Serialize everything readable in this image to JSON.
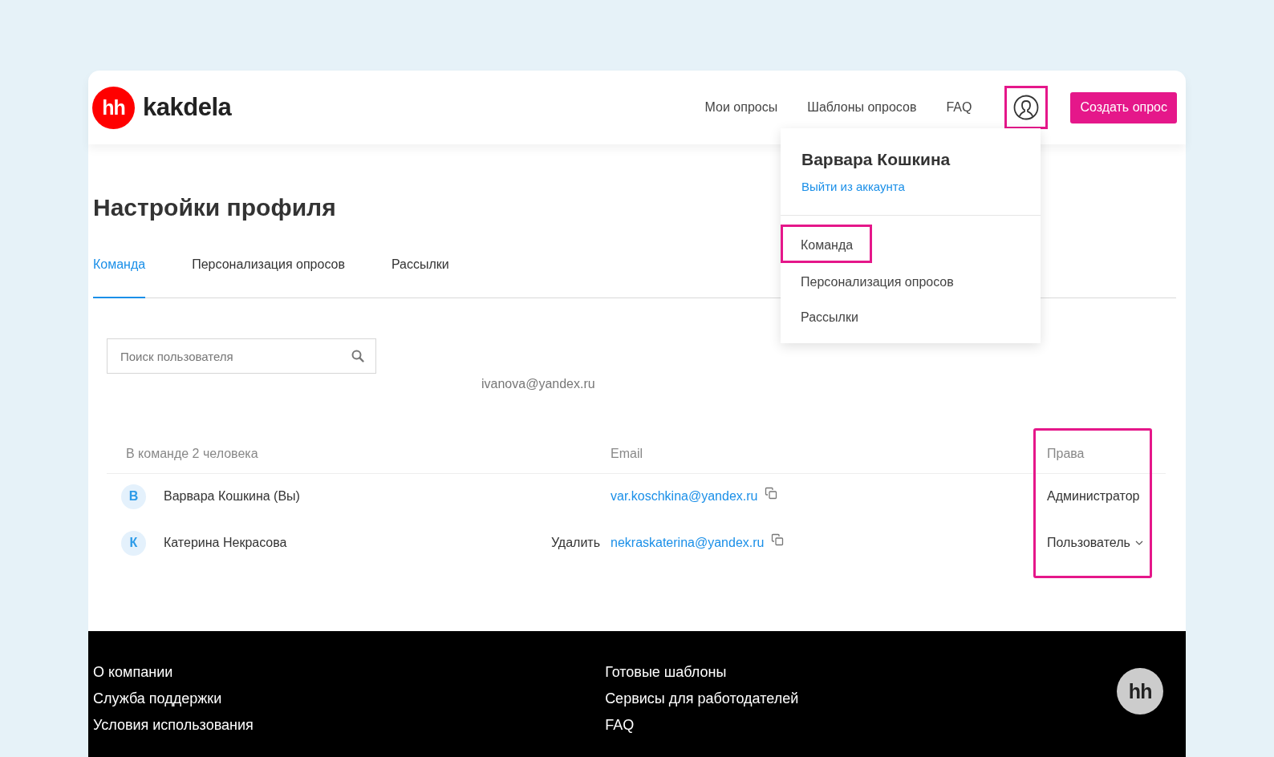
{
  "header": {
    "logo_mark": "hh",
    "brand": "kakdela",
    "nav": [
      "Мои опросы",
      "Шаблоны опросов",
      "FAQ"
    ],
    "profile_button_highlighted": true,
    "create_button": "Создать опрос"
  },
  "account_menu": {
    "user_name": "Варвара Кошкина",
    "logout": "Выйти из аккаунта",
    "items": [
      {
        "label": "Команда",
        "highlighted": true
      },
      {
        "label": "Персонализация опросов",
        "highlighted": false
      },
      {
        "label": "Рассылки",
        "highlighted": false
      }
    ]
  },
  "page_title": "Настройки профиля",
  "tabs": [
    {
      "label": "Команда",
      "selected": true
    },
    {
      "label": "Персонализация опросов",
      "selected": false
    },
    {
      "label": "Рассылки",
      "selected": false
    }
  ],
  "search": {
    "placeholder": "Поиск пользователя"
  },
  "floating_email": "ivanova@yandex.ru",
  "team_table": {
    "columns": [
      "В команде 2 человека",
      "Email",
      "Права"
    ],
    "rights_column_highlighted": true,
    "rows": [
      {
        "initial": "В",
        "name": "Варвара Кошкина (Вы)",
        "delete": null,
        "email": "var.koschkina@yandex.ru",
        "rights": "Администратор",
        "dropdown": false
      },
      {
        "initial": "К",
        "name": "Катерина Некрасова",
        "delete": "Удалить",
        "email": "nekraskaterina@yandex.ru",
        "rights": "Пользователь",
        "dropdown": true
      }
    ]
  },
  "footer": {
    "columns": [
      [
        "О компании",
        "Служба поддержки",
        "Условия использования"
      ],
      [
        "Готовые шаблоны",
        "Сервисы для работодателей",
        "FAQ"
      ]
    ],
    "logo_mark": "hh"
  }
}
